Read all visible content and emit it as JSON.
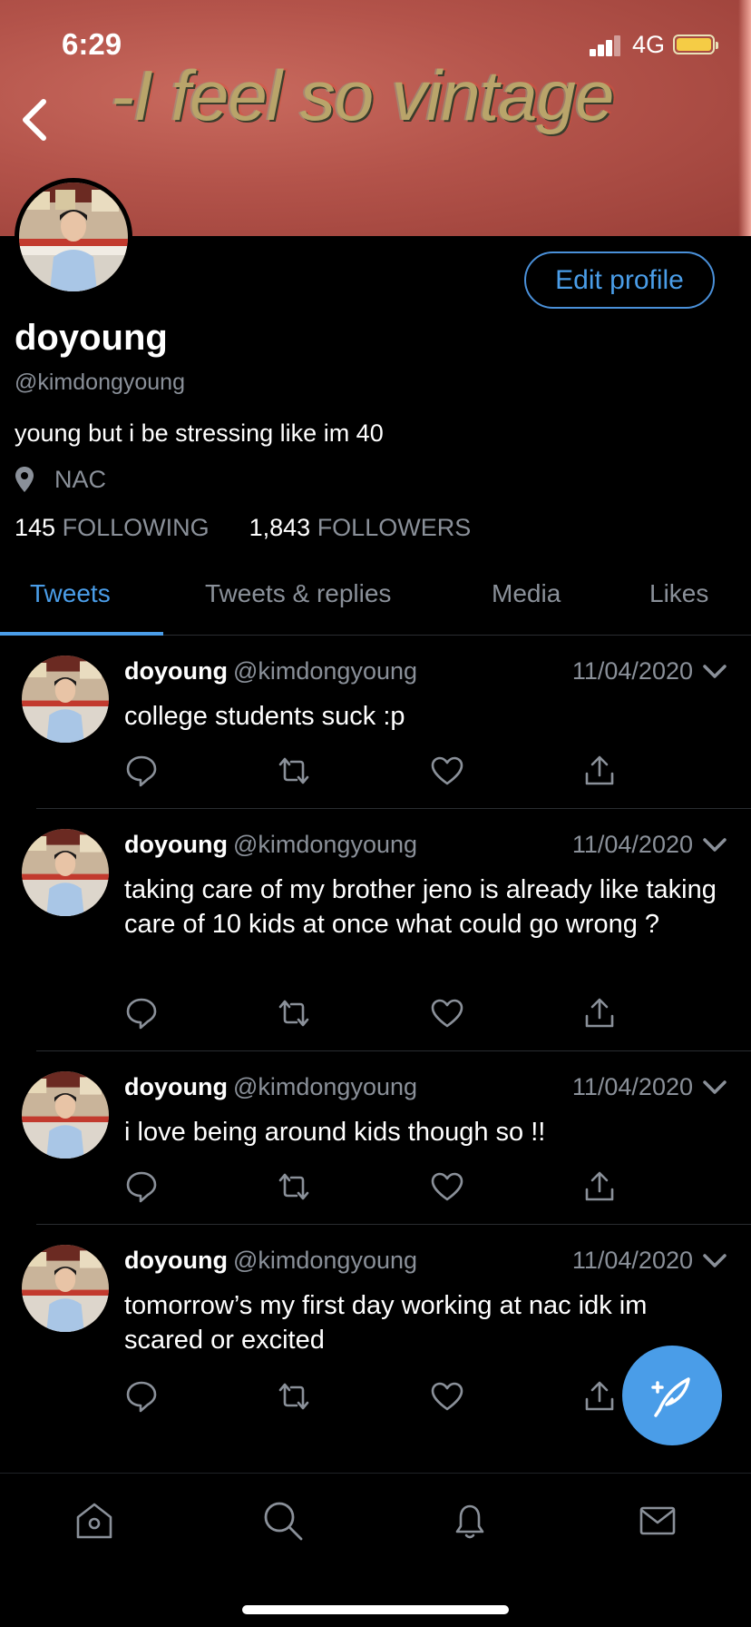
{
  "status_bar": {
    "time": "6:29",
    "network": "4G"
  },
  "banner": {
    "text": "-I feel so vintage"
  },
  "profile": {
    "name": "doyoung",
    "handle": "@kimdongyoung",
    "bio": "young but i be stressing like im 40",
    "location": "NAC",
    "following_count": "145",
    "following_label": "FOLLOWING",
    "followers_count": "1,843",
    "followers_label": "FOLLOWERS",
    "edit_label": "Edit profile"
  },
  "tabs": [
    {
      "label": "Tweets",
      "active": true
    },
    {
      "label": "Tweets & replies",
      "active": false
    },
    {
      "label": "Media",
      "active": false
    },
    {
      "label": "Likes",
      "active": false
    }
  ],
  "tweets": [
    {
      "name": "doyoung",
      "handle": "@kimdongyoung",
      "date": "11/04/2020",
      "text": "college students suck :p"
    },
    {
      "name": "doyoung",
      "handle": "@kimdongyoung",
      "date": "11/04/2020",
      "text": "taking care of my brother jeno is already like taking care of 10 kids at once what could go wrong ?"
    },
    {
      "name": "doyoung",
      "handle": "@kimdongyoung",
      "date": "11/04/2020",
      "text": "i love being around kids though so !!"
    },
    {
      "name": "doyoung",
      "handle": "@kimdongyoung",
      "date": "11/04/2020",
      "text": "tomorrow’s my first day working at nac idk im scared or excited"
    }
  ],
  "icons": {
    "back": "chevron-left-icon",
    "location": "map-pin-icon",
    "reply": "reply-icon",
    "retweet": "retweet-icon",
    "like": "heart-icon",
    "share": "share-icon",
    "compose": "compose-tweet-icon",
    "nav": [
      "home-icon",
      "search-icon",
      "notifications-icon",
      "messages-icon"
    ]
  },
  "colors": {
    "accent": "#4a9de8",
    "background": "#000000",
    "muted": "#8a9099",
    "banner": "#b3534a"
  }
}
